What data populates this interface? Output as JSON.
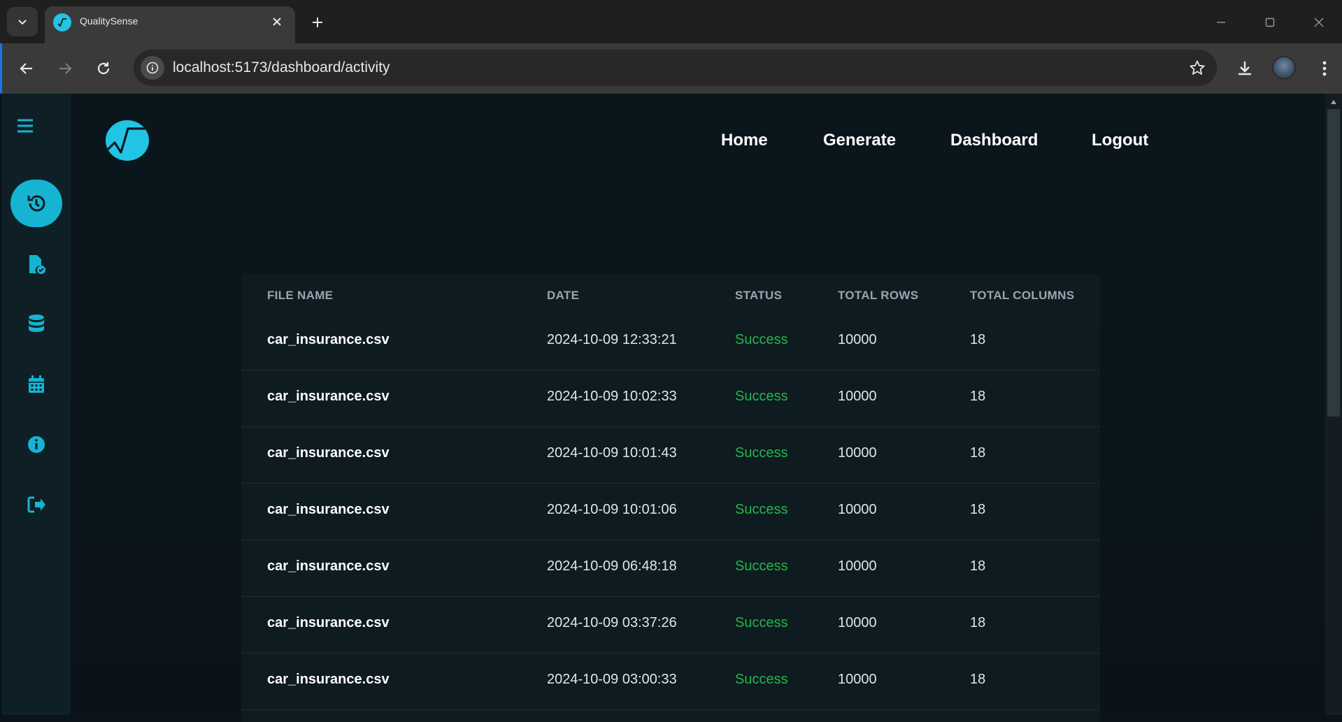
{
  "browser": {
    "tab_title": "QualitySense",
    "url": "localhost:5173/dashboard/activity"
  },
  "nav": {
    "home": "Home",
    "generate": "Generate",
    "dashboard": "Dashboard",
    "logout": "Logout"
  },
  "sidebar": {
    "items": [
      "menu-icon",
      "history-icon",
      "file-check-icon",
      "database-icon",
      "calendar-icon",
      "info-icon",
      "logout-icon"
    ],
    "active": "history-icon",
    "accent": "#16b4d2"
  },
  "table": {
    "headers": [
      "FILE NAME",
      "DATE",
      "STATUS",
      "TOTAL ROWS",
      "TOTAL COLUMNS"
    ],
    "rows": [
      {
        "file": "car_insurance.csv",
        "date": "2024-10-09 12:33:21",
        "status": "Success",
        "rows": "10000",
        "cols": "18"
      },
      {
        "file": "car_insurance.csv",
        "date": "2024-10-09 10:02:33",
        "status": "Success",
        "rows": "10000",
        "cols": "18"
      },
      {
        "file": "car_insurance.csv",
        "date": "2024-10-09 10:01:43",
        "status": "Success",
        "rows": "10000",
        "cols": "18"
      },
      {
        "file": "car_insurance.csv",
        "date": "2024-10-09 10:01:06",
        "status": "Success",
        "rows": "10000",
        "cols": "18"
      },
      {
        "file": "car_insurance.csv",
        "date": "2024-10-09 06:48:18",
        "status": "Success",
        "rows": "10000",
        "cols": "18"
      },
      {
        "file": "car_insurance.csv",
        "date": "2024-10-09 03:37:26",
        "status": "Success",
        "rows": "10000",
        "cols": "18"
      },
      {
        "file": "car_insurance.csv",
        "date": "2024-10-09 03:00:33",
        "status": "Success",
        "rows": "10000",
        "cols": "18"
      }
    ]
  }
}
